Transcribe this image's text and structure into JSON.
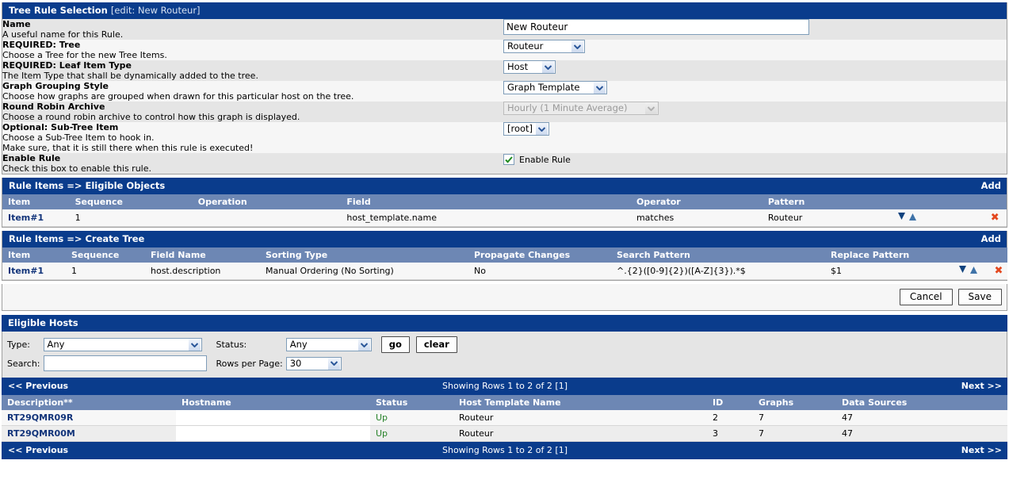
{
  "rule_panel": {
    "title": "Tree Rule Selection",
    "subtitle": "[edit: New Routeur]",
    "fields": [
      {
        "label": "Name",
        "desc": "A useful name for this Rule.",
        "control": "text",
        "value": "New Routeur",
        "placeholder": ""
      },
      {
        "label": "REQUIRED: Tree",
        "desc": "Choose a Tree for the new Tree Items.",
        "control": "select",
        "value": "Routeur"
      },
      {
        "label": "REQUIRED: Leaf Item Type",
        "desc": "The Item Type that shall be dynamically added to the tree.",
        "control": "select",
        "value": "Host"
      },
      {
        "label": "Graph Grouping Style",
        "desc": "Choose how graphs are grouped when drawn for this particular host on the tree.",
        "control": "select",
        "value": "Graph Template"
      },
      {
        "label": "Round Robin Archive",
        "desc": "Choose a round robin archive to control how this graph is displayed.",
        "control": "select-disabled",
        "value": "Hourly (1 Minute Average)"
      },
      {
        "label": "Optional: Sub-Tree Item",
        "desc": "Choose a Sub-Tree Item to hook in.",
        "desc2": "Make sure, that it is still there when this rule is executed!",
        "control": "select",
        "value": "[root]"
      },
      {
        "label": "Enable Rule",
        "desc": "Check this box to enable this rule.",
        "control": "checkbox",
        "value": "Enable Rule",
        "checked": true
      }
    ]
  },
  "eligible_objects": {
    "title": "Rule Items => Eligible Objects",
    "add_label": "Add",
    "columns": [
      "Item",
      "Sequence",
      "Operation",
      "Field",
      "Operator",
      "Pattern"
    ],
    "rows": [
      {
        "item": "Item#1",
        "sequence": "1",
        "operation": "",
        "field": "host_template.name",
        "operator": "matches",
        "pattern": "Routeur"
      }
    ]
  },
  "create_tree": {
    "title": "Rule Items => Create Tree",
    "add_label": "Add",
    "columns": [
      "Item",
      "Sequence",
      "Field Name",
      "Sorting Type",
      "Propagate Changes",
      "Search Pattern",
      "Replace Pattern"
    ],
    "rows": [
      {
        "item": "Item#1",
        "sequence": "1",
        "field_name": "host.description",
        "sorting_type": "Manual Ordering (No Sorting)",
        "propagate_changes": "No",
        "search_pattern": "^.{2}([0-9]{2})([A-Z]{3}).*$",
        "replace_pattern": "$1"
      }
    ]
  },
  "actions": {
    "cancel_label": "Cancel",
    "save_label": "Save"
  },
  "eligible_hosts": {
    "title": "Eligible Hosts",
    "filter": {
      "type_label": "Type:",
      "type_value": "Any",
      "status_label": "Status:",
      "status_value": "Any",
      "go_label": "go",
      "clear_label": "clear",
      "search_label": "Search:",
      "search_value": "",
      "rows_label": "Rows per Page:",
      "rows_value": "30"
    },
    "pager": {
      "previous": "<< Previous",
      "showing": "Showing Rows 1 to 2 of 2 [1]",
      "next": "Next >>"
    },
    "columns": [
      "Description**",
      "Hostname",
      "Status",
      "Host Template Name",
      "ID",
      "Graphs",
      "Data Sources"
    ],
    "rows": [
      {
        "description": "RT29QMR09R",
        "hostname": "",
        "status": "Up",
        "host_template_name": "Routeur",
        "id": "2",
        "graphs": "7",
        "data_sources": "47"
      },
      {
        "description": "RT29QMR00M",
        "hostname": "",
        "status": "Up",
        "host_template_name": "Routeur",
        "id": "3",
        "graphs": "7",
        "data_sources": "47"
      }
    ]
  },
  "colors": {
    "header_bar": "#0a3c8c",
    "column_header": "#6d87b4",
    "link": "#12347a",
    "status_up": "#278229",
    "delete": "#e4481f"
  }
}
